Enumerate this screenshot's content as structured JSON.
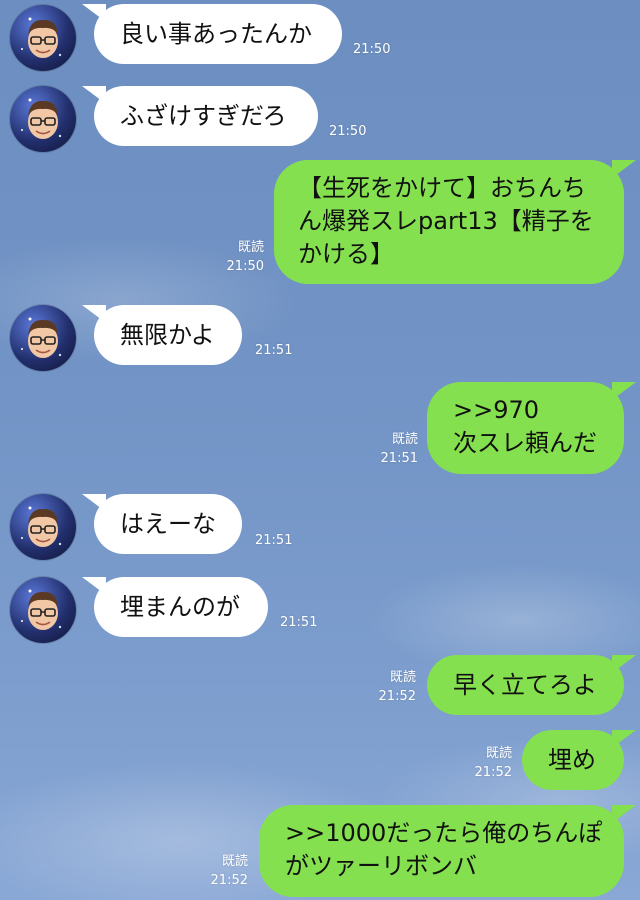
{
  "messages": [
    {
      "side": "in",
      "lines": [
        "良い事あったんか"
      ],
      "time": "21:50"
    },
    {
      "side": "in",
      "lines": [
        "ふざけすぎだろ"
      ],
      "time": "21:50"
    },
    {
      "side": "out",
      "lines": [
        "【生死をかけて】おちんち",
        "ん爆発スレpart13【精子を",
        "かける】"
      ],
      "read": "既読",
      "time": "21:50"
    },
    {
      "side": "in",
      "lines": [
        "無限かよ"
      ],
      "time": "21:51"
    },
    {
      "side": "out",
      "lines": [
        ">>970",
        "次スレ頼んだ"
      ],
      "read": "既読",
      "time": "21:51"
    },
    {
      "side": "in",
      "lines": [
        "はえーな"
      ],
      "time": "21:51"
    },
    {
      "side": "in",
      "lines": [
        "埋まんのが"
      ],
      "time": "21:51"
    },
    {
      "side": "out",
      "lines": [
        "早く立てろよ"
      ],
      "read": "既読",
      "time": "21:52"
    },
    {
      "side": "out",
      "lines": [
        "埋め"
      ],
      "read": "既読",
      "time": "21:52"
    },
    {
      "side": "out",
      "lines": [
        ">>1000だったら俺のちんぽ",
        "がツァーリボンバ"
      ],
      "read": "既読",
      "time": "21:52"
    }
  ],
  "colors": {
    "incoming": "#ffffff",
    "outgoing": "#84e04f",
    "background": "#7193c5"
  },
  "icons": {
    "avatar": "user-avatar-icon"
  }
}
